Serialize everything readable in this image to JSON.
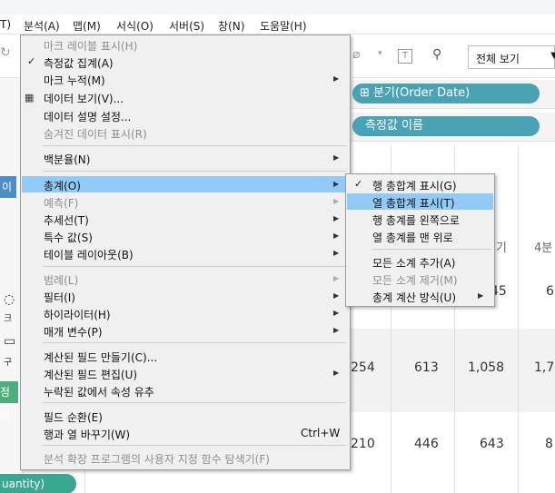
{
  "menubar": {
    "items": [
      "T)",
      "분석(A)",
      "맵(M)",
      "서식(O)",
      "서버(S)",
      "창(N)",
      "도움말(H)"
    ]
  },
  "toolbar": {
    "view_select": "전체 보기"
  },
  "shelves": {
    "columns_pill": "⊞ 분기(Order Date)",
    "rows_pill": "측정값 이름"
  },
  "left_panel": {
    "blue_tag": "이",
    "icon_label_1": "크",
    "icon_label_2": "구",
    "green_tag": "정값",
    "quantity_pill": "uantity)"
  },
  "grid": {
    "headers": [
      "기",
      "4분"
    ],
    "rows": [
      [
        "",
        "45",
        "6"
      ],
      [
        "254",
        "613",
        "1,058",
        "1,7"
      ],
      [
        "210",
        "446",
        "643",
        "8"
      ]
    ]
  },
  "analysis_menu": {
    "items": [
      {
        "label": "마크 레이블 표시(H)",
        "disabled": true
      },
      {
        "label": "측정값 집계(A)",
        "checked": true
      },
      {
        "label": "마크 누적(M)",
        "submenu": true
      },
      {
        "label": "데이터 보기(V)...",
        "icon": "list"
      },
      {
        "label": "데이터 설명 설정..."
      },
      {
        "label": "숨겨진 데이터 표시(R)",
        "disabled": true
      },
      {
        "label": "백분율(N)",
        "submenu": true
      },
      {
        "label": "총계(O)",
        "submenu": true,
        "highlighted": true
      },
      {
        "label": "예측(F)",
        "submenu": true,
        "disabled": true
      },
      {
        "label": "추세선(T)",
        "submenu": true
      },
      {
        "label": "특수 값(S)",
        "submenu": true
      },
      {
        "label": "테이블 레이아웃(B)",
        "submenu": true
      },
      {
        "label": "범례(L)",
        "submenu": true,
        "disabled": true
      },
      {
        "label": "필터(I)",
        "submenu": true
      },
      {
        "label": "하이라이터(H)",
        "submenu": true
      },
      {
        "label": "매개 변수(P)",
        "submenu": true
      },
      {
        "label": "계산된 필드 만들기(C)..."
      },
      {
        "label": "계산된 필드 편집(U)",
        "submenu": true
      },
      {
        "label": "누락된 값에서 속성 유추"
      },
      {
        "label": "필드 순환(E)"
      },
      {
        "label": "행과 열 바꾸기(W)",
        "shortcut": "Ctrl+W"
      },
      {
        "label": "분석 확장 프로그램의 사용자 지정 함수 탐색기(F)",
        "disabled": true
      }
    ]
  },
  "totals_submenu": {
    "items": [
      {
        "label": "행 총합계 표시(G)",
        "checked": true
      },
      {
        "label": "열 총합계 표시(T)",
        "highlighted": true
      },
      {
        "label": "행 총계를 왼쪽으로"
      },
      {
        "label": "열 총계를 맨 위로"
      },
      {
        "label": "모든 소계 추가(A)"
      },
      {
        "label": "모든 소계 제거(M)",
        "disabled": true
      },
      {
        "label": "총계 계산 방식(U)",
        "submenu": true
      }
    ]
  },
  "colors": {
    "highlight": "#91c9f7",
    "menu_bg": "#f0f0f0",
    "pill": "#4aa3b4",
    "quantity_pill": "#3aa88f"
  }
}
